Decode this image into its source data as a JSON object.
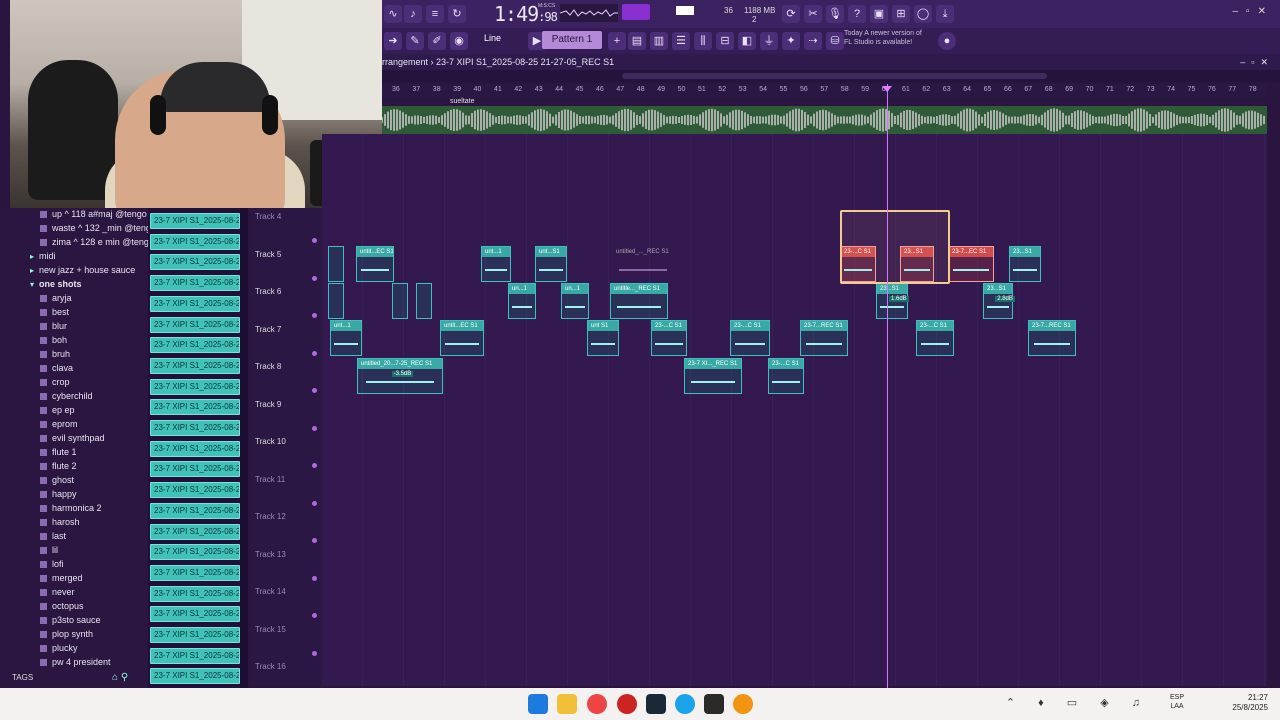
{
  "app": {
    "title": "FL Studio",
    "time_main": "1:49",
    "time_sub": ":98",
    "time_unit_label": "M:S:CS",
    "cpu": "36",
    "memory": "1188 MB",
    "voices": "2",
    "snap": "Line",
    "pattern": "Pattern 1",
    "notice_line1": "Today  A newer version of",
    "notice_line2": "FL Studio is available!"
  },
  "playlist": {
    "title": "rrangement  ›  23-7 XIPI S1_2025-08-25 21-27-05_REC S1",
    "marker": "sueltate",
    "ruler": [
      "36",
      "37",
      "38",
      "39",
      "40",
      "41",
      "42",
      "43",
      "44",
      "45",
      "46",
      "47",
      "48",
      "49",
      "50",
      "51",
      "52",
      "53",
      "54",
      "55",
      "56",
      "57",
      "58",
      "59",
      "60",
      "61",
      "62",
      "63",
      "64",
      "65",
      "66",
      "67",
      "68",
      "69",
      "70",
      "71",
      "72",
      "73",
      "74",
      "75",
      "76",
      "77",
      "78"
    ],
    "tracks": [
      {
        "name": "Track 4",
        "dim": true
      },
      {
        "name": "Track 5",
        "dim": false
      },
      {
        "name": "Track 6",
        "dim": false
      },
      {
        "name": "Track 7",
        "dim": false
      },
      {
        "name": "Track 8",
        "dim": false
      },
      {
        "name": "Track 9",
        "dim": false
      },
      {
        "name": "Track 10",
        "dim": false
      },
      {
        "name": "Track 11",
        "dim": true
      },
      {
        "name": "Track 12",
        "dim": true
      },
      {
        "name": "Track 13",
        "dim": true
      },
      {
        "name": "Track 14",
        "dim": true
      },
      {
        "name": "Track 15",
        "dim": true
      },
      {
        "name": "Track 16",
        "dim": true
      }
    ],
    "clips": [
      {
        "label": "untit...EC S1",
        "vol": ""
      },
      {
        "label": "unt...1",
        "vol": ""
      },
      {
        "label": "unt...S1",
        "vol": ""
      },
      {
        "label": "untitled_..._REC S1",
        "vol": ""
      },
      {
        "label": "23-...C S1",
        "vol": ""
      },
      {
        "label": "23...S1",
        "vol": ""
      },
      {
        "label": "23-7...EC S1",
        "vol": ""
      },
      {
        "label": "23...S1",
        "vol": ""
      },
      {
        "label": "un...1",
        "vol": ""
      },
      {
        "label": "un...1",
        "vol": ""
      },
      {
        "label": "untitle..._REC S1",
        "vol": ""
      },
      {
        "label": "23...S1",
        "vol": "1.6dB"
      },
      {
        "label": "23...S1",
        "vol": "2.8dB"
      },
      {
        "label": "unt...1",
        "vol": ""
      },
      {
        "label": "untit...EC S1",
        "vol": ""
      },
      {
        "label": "unt S1",
        "vol": ""
      },
      {
        "label": "23-...C S1",
        "vol": ""
      },
      {
        "label": "23-...C S1",
        "vol": ""
      },
      {
        "label": "23-7...REC S1",
        "vol": ""
      },
      {
        "label": "23-...C S1",
        "vol": ""
      },
      {
        "label": "23-7...REC S1",
        "vol": ""
      },
      {
        "label": "untitled_20...7-25_REC S1",
        "vol": "-3.5dB"
      },
      {
        "label": "23-7 XI..._REC S1",
        "vol": ""
      },
      {
        "label": "23-...C S1",
        "vol": ""
      }
    ]
  },
  "browser": {
    "items": [
      {
        "label": "up ^ 118 a#maj @tengo",
        "type": "file"
      },
      {
        "label": "waste ^ 132 _min @tengo",
        "type": "file"
      },
      {
        "label": "zima ^ 128 e min @tengo",
        "type": "file"
      },
      {
        "label": "midi",
        "type": "folder"
      },
      {
        "label": "new jazz + house sauce",
        "type": "folder"
      },
      {
        "label": "one shots",
        "type": "folder-open"
      },
      {
        "label": "aryja",
        "type": "file"
      },
      {
        "label": "best",
        "type": "file"
      },
      {
        "label": "blur",
        "type": "file"
      },
      {
        "label": "boh",
        "type": "file"
      },
      {
        "label": "bruh",
        "type": "file"
      },
      {
        "label": "clava",
        "type": "file"
      },
      {
        "label": "crop",
        "type": "file"
      },
      {
        "label": "cyberchild",
        "type": "file"
      },
      {
        "label": "ep ep",
        "type": "file"
      },
      {
        "label": "eprom",
        "type": "file"
      },
      {
        "label": "evil synthpad",
        "type": "file"
      },
      {
        "label": "flute 1",
        "type": "file"
      },
      {
        "label": "flute 2",
        "type": "file"
      },
      {
        "label": "ghost",
        "type": "file"
      },
      {
        "label": "happy",
        "type": "file"
      },
      {
        "label": "harmonica 2",
        "type": "file"
      },
      {
        "label": "harosh",
        "type": "file"
      },
      {
        "label": "last",
        "type": "file"
      },
      {
        "label": "lil",
        "type": "file"
      },
      {
        "label": "lofi",
        "type": "file"
      },
      {
        "label": "merged",
        "type": "file"
      },
      {
        "label": "never",
        "type": "file"
      },
      {
        "label": "octopus",
        "type": "file"
      },
      {
        "label": "p3sto sauce",
        "type": "file"
      },
      {
        "label": "plop synth",
        "type": "file"
      },
      {
        "label": "plucky",
        "type": "file"
      },
      {
        "label": "pw 4 president",
        "type": "file"
      }
    ],
    "tags_label": "TAGS"
  },
  "channels": {
    "label": "23-7 XIPI S1_2025-08-2..."
  },
  "taskbar": {
    "lang1": "ESP",
    "lang2": "LAA",
    "time": "21:27",
    "date": "25/8/2025"
  }
}
